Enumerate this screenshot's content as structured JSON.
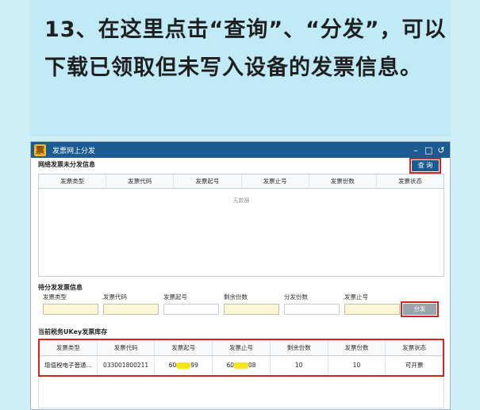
{
  "banner": {
    "text": "13、在这里点击“查询”、“分发”，可以下载已领取但未写入设备的发票信息。"
  },
  "window": {
    "title": "发票网上分发",
    "icon_char": "票",
    "controls": [
      "–",
      "□",
      "↺"
    ]
  },
  "section1": {
    "label": "网络发票未分发信息",
    "query_label": "查 询",
    "columns": [
      "发票类型",
      "发票代码",
      "发票起号",
      "发票止号",
      "发票份数",
      "发票状态"
    ],
    "empty_text": "无数据"
  },
  "section2": {
    "label": "待分发发票信息",
    "fields": [
      "发票类型",
      "发票代码",
      "发票起号",
      "剩余份数",
      "分发份数",
      "发票止号"
    ],
    "distribute_label": "分发"
  },
  "section3": {
    "label": "当前税务UKey发票库存",
    "columns": [
      "发票类型",
      "发票代码",
      "发票起号",
      "发票止号",
      "剩余份数",
      "发票份数",
      "发票状态"
    ],
    "row": {
      "type": "增值税电子普通...",
      "code": "033001800211",
      "start_prefix": "60",
      "start_suffix": "99",
      "end_prefix": "60",
      "end_suffix": "08",
      "remaining": "10",
      "count": "10",
      "status": "可开票"
    }
  },
  "colors": {
    "titlebar": "#1c5a92",
    "highlight": "#d92020",
    "mask": "#f7e41a"
  }
}
